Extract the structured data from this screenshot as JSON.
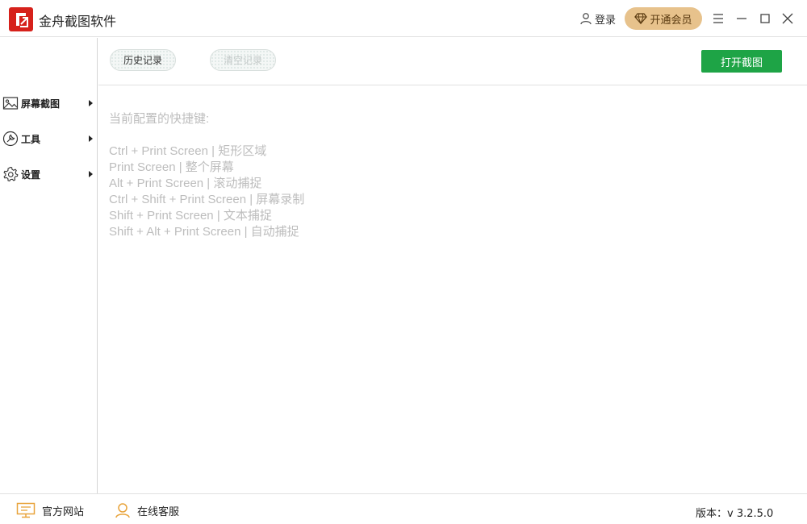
{
  "app": {
    "title": "金舟截图软件",
    "logo_icon": "app-logo-icon",
    "accent": "#d6211b"
  },
  "header": {
    "login_label": "登录",
    "vip_label": "开通会员",
    "vip_color": "#e7c28c"
  },
  "sidebar": {
    "items": [
      {
        "label": "屏幕截图",
        "icon": "image-icon"
      },
      {
        "label": "工具",
        "icon": "wrench-icon"
      },
      {
        "label": "设置",
        "icon": "gear-icon"
      }
    ]
  },
  "toolbar": {
    "history_label": "历史记录",
    "clear_label": "清空记录",
    "open_label": "打开截图",
    "open_color": "#1ea446"
  },
  "main": {
    "heading": "当前配置的快捷键:",
    "shortcuts": [
      "Ctrl + Print Screen  |  矩形区域",
      "Print Screen  |  整个屏幕",
      "Alt + Print Screen  |  滚动捕捉",
      "Ctrl + Shift + Print Screen  |  屏幕录制",
      "Shift + Print Screen  |  文本捕捉",
      "Shift + Alt + Print Screen  |  自动捕捉"
    ]
  },
  "footer": {
    "website_label": "官方网站",
    "support_label": "在线客服",
    "version": "版本：v 3.2.5.0",
    "icon_color": "#e8a33a"
  }
}
